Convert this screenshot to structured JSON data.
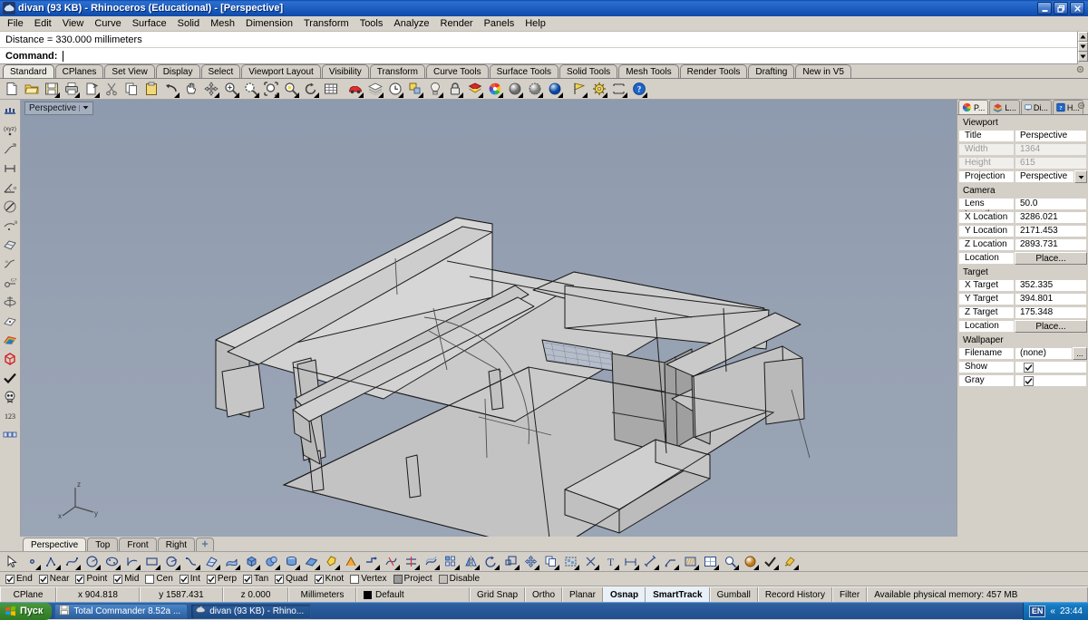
{
  "window": {
    "title": "divan (93 KB) - Rhinoceros (Educational) - [Perspective]",
    "icon": "rhino-icon",
    "minimize_label": "Minimize",
    "restore_label": "Restore",
    "close_label": "Close"
  },
  "menu": {
    "items": [
      "File",
      "Edit",
      "View",
      "Curve",
      "Surface",
      "Solid",
      "Mesh",
      "Dimension",
      "Transform",
      "Tools",
      "Analyze",
      "Render",
      "Panels",
      "Help"
    ]
  },
  "command_area": {
    "history": "Distance = 330.000 millimeters",
    "prompt_label": "Command:",
    "input_value": "",
    "scroll_up": "▲",
    "scroll_down": "▼"
  },
  "toolbar_tabs": {
    "items": [
      "Standard",
      "CPlanes",
      "Set View",
      "Display",
      "Select",
      "Viewport Layout",
      "Visibility",
      "Transform",
      "Curve Tools",
      "Surface Tools",
      "Solid Tools",
      "Mesh Tools",
      "Render Tools",
      "Drafting",
      "New in V5"
    ],
    "active": "Standard",
    "options_icon": "gear-icon"
  },
  "main_toolbar": {
    "buttons": [
      {
        "name": "new-file-icon",
        "label": "New"
      },
      {
        "name": "open-file-icon",
        "label": "Open"
      },
      {
        "name": "save-file-icon",
        "label": "Save"
      },
      {
        "name": "print-icon",
        "label": "Print"
      },
      {
        "name": "copy-page-icon",
        "label": "Copy viewport"
      },
      {
        "name": "cut-icon",
        "label": "Cut"
      },
      {
        "name": "copy-icon",
        "label": "Copy"
      },
      {
        "name": "paste-icon",
        "label": "Paste"
      },
      {
        "name": "undo-icon",
        "label": "Undo"
      },
      {
        "name": "pan-hand-icon",
        "label": "Pan"
      },
      {
        "name": "move-arrows-icon",
        "label": "Move"
      },
      {
        "name": "zoom-in-icon",
        "label": "Zoom in"
      },
      {
        "name": "zoom-window-icon",
        "label": "Zoom window"
      },
      {
        "name": "zoom-extents-icon",
        "label": "Zoom extents"
      },
      {
        "name": "zoom-selected-icon",
        "label": "Zoom selected"
      },
      {
        "name": "rotate-view-icon",
        "label": "Rotate view"
      },
      {
        "name": "grid-icon",
        "label": "Grid"
      },
      {
        "name": "render-car-icon",
        "label": "Render"
      },
      {
        "name": "layers-icon",
        "label": "Layers"
      },
      {
        "name": "clock-icon",
        "label": "History"
      },
      {
        "name": "object-props-icon",
        "label": "Properties"
      },
      {
        "name": "lightbulb-icon",
        "label": "Lights"
      },
      {
        "name": "lock-icon",
        "label": "Lock"
      },
      {
        "name": "shade-icon",
        "label": "Shade"
      },
      {
        "name": "color-wheel-icon",
        "label": "Color"
      },
      {
        "name": "sphere-shaded-icon",
        "label": "Shaded view"
      },
      {
        "name": "sphere-ghost-icon",
        "label": "Ghosted view"
      },
      {
        "name": "sphere-render-icon",
        "label": "Rendered view"
      },
      {
        "name": "flag-icon",
        "label": "Named view"
      },
      {
        "name": "options-gear-icon",
        "label": "Options"
      },
      {
        "name": "dimension-icon",
        "label": "Dimension"
      },
      {
        "name": "help-icon",
        "label": "Help"
      }
    ]
  },
  "left_toolbar": {
    "buttons": [
      {
        "name": "points-row-icon"
      },
      {
        "name": "xyz-point-icon"
      },
      {
        "name": "curve-tangent-icon"
      },
      {
        "name": "distance-icon"
      },
      {
        "name": "angle-icon"
      },
      {
        "name": "length-icon"
      },
      {
        "name": "radius-icon"
      },
      {
        "name": "surface-area-icon"
      },
      {
        "name": "curvature-icon"
      },
      {
        "name": "degree-icon"
      },
      {
        "name": "volume-icon"
      },
      {
        "name": "mass-icon"
      },
      {
        "name": "rainbow-icon"
      },
      {
        "name": "red-box-icon"
      },
      {
        "name": "check-icon"
      },
      {
        "name": "skull-icon"
      },
      {
        "name": "numbers-123-icon"
      },
      {
        "name": "grid-nums-icon"
      }
    ]
  },
  "viewport": {
    "title": "Perspective",
    "dropdown_icon": "chevron-down-icon",
    "axis": {
      "x": "x",
      "y": "y",
      "z": "z"
    },
    "background_color": "#93a0b1",
    "object_fill": "#c8c8c8",
    "object_fill_dark": "#a8a8a8",
    "edge_color": "#1a1a1a"
  },
  "viewport_tabs": {
    "items": [
      "Perspective",
      "Top",
      "Front",
      "Right"
    ],
    "active": "Perspective",
    "add_label": "+"
  },
  "properties_panel": {
    "tabs": [
      {
        "name": "properties-tab",
        "label": "P...",
        "icon": "color-wheel-icon"
      },
      {
        "name": "layers-tab",
        "label": "L...",
        "icon": "layers-icon"
      },
      {
        "name": "display-tab",
        "label": "Di...",
        "icon": "monitor-icon"
      },
      {
        "name": "help-tab",
        "label": "H...",
        "icon": "help-icon"
      }
    ],
    "active_tab": "P...",
    "gear_icon": "gear-icon",
    "sections": [
      {
        "title": "Viewport",
        "rows": [
          {
            "key": "Title",
            "value": "Perspective",
            "type": "text"
          },
          {
            "key": "Width",
            "value": "1364",
            "type": "text",
            "disabled": true
          },
          {
            "key": "Height",
            "value": "615",
            "type": "text",
            "disabled": true
          },
          {
            "key": "Projection",
            "value": "Perspective",
            "type": "dropdown"
          }
        ]
      },
      {
        "title": "Camera",
        "rows": [
          {
            "key": "Lens Length",
            "value": "50.0",
            "type": "text"
          },
          {
            "key": "X Location",
            "value": "3286.021",
            "type": "text"
          },
          {
            "key": "Y Location",
            "value": "2171.453",
            "type": "text"
          },
          {
            "key": "Z Location",
            "value": "2893.731",
            "type": "text"
          },
          {
            "key": "Location",
            "value": "Place...",
            "type": "button"
          }
        ]
      },
      {
        "title": "Target",
        "rows": [
          {
            "key": "X Target",
            "value": "352.335",
            "type": "text"
          },
          {
            "key": "Y Target",
            "value": "394.801",
            "type": "text"
          },
          {
            "key": "Z Target",
            "value": "175.348",
            "type": "text"
          },
          {
            "key": "Location",
            "value": "Place...",
            "type": "button"
          }
        ]
      },
      {
        "title": "Wallpaper",
        "rows": [
          {
            "key": "Filename",
            "value": "(none)",
            "type": "file"
          },
          {
            "key": "Show",
            "value": "",
            "type": "checkbox",
            "checked": true
          },
          {
            "key": "Gray",
            "value": "",
            "type": "checkbox",
            "checked": true
          }
        ]
      }
    ]
  },
  "bottom_toolbar": {
    "buttons": [
      {
        "name": "select-arrow-icon"
      },
      {
        "name": "point-icon"
      },
      {
        "name": "polyline-icon"
      },
      {
        "name": "curve-icon"
      },
      {
        "name": "circle-icon"
      },
      {
        "name": "ellipse-icon"
      },
      {
        "name": "arc-icon"
      },
      {
        "name": "rectangle-icon"
      },
      {
        "name": "polygon-icon"
      },
      {
        "name": "freeform-curve-icon"
      },
      {
        "name": "surface-from-curves-icon"
      },
      {
        "name": "surface-patch-icon"
      },
      {
        "name": "box-icon"
      },
      {
        "name": "sphere-icon"
      },
      {
        "name": "cylinder-icon"
      },
      {
        "name": "plane-surface-icon"
      },
      {
        "name": "boolean-union-icon"
      },
      {
        "name": "fillet-icon"
      },
      {
        "name": "chamfer-icon"
      },
      {
        "name": "trim-icon"
      },
      {
        "name": "split-icon"
      },
      {
        "name": "offset-icon"
      },
      {
        "name": "array-icon"
      },
      {
        "name": "mirror-icon"
      },
      {
        "name": "rotate-icon"
      },
      {
        "name": "scale-icon"
      },
      {
        "name": "move-icon"
      },
      {
        "name": "copy-obj-icon"
      },
      {
        "name": "group-icon"
      },
      {
        "name": "explode-icon"
      },
      {
        "name": "text-icon"
      },
      {
        "name": "dim-linear-icon"
      },
      {
        "name": "dim-aligned-icon"
      },
      {
        "name": "leader-icon"
      },
      {
        "name": "hatch-icon"
      },
      {
        "name": "layout-icon"
      },
      {
        "name": "analyze-icon"
      },
      {
        "name": "render-tools-icon"
      },
      {
        "name": "check-obj-icon"
      },
      {
        "name": "paint-icon"
      }
    ]
  },
  "osnap": {
    "items": [
      {
        "label": "End",
        "checked": true
      },
      {
        "label": "Near",
        "checked": true
      },
      {
        "label": "Point",
        "checked": true
      },
      {
        "label": "Mid",
        "checked": true
      },
      {
        "label": "Cen",
        "checked": false
      },
      {
        "label": "Int",
        "checked": true
      },
      {
        "label": "Perp",
        "checked": true
      },
      {
        "label": "Tan",
        "checked": true
      },
      {
        "label": "Quad",
        "checked": true
      },
      {
        "label": "Knot",
        "checked": true
      },
      {
        "label": "Vertex",
        "checked": false
      },
      {
        "label": "Project",
        "checked": false,
        "style": "solid"
      },
      {
        "label": "Disable",
        "checked": false,
        "style": "grey"
      }
    ]
  },
  "statusbar": {
    "cplane_label": "CPlane",
    "x": "x 904.818",
    "y": "y 1587.431",
    "z": "z 0.000",
    "units": "Millimeters",
    "layer": "Default",
    "layer_color": "#000000",
    "toggles": [
      {
        "label": "Grid Snap",
        "active": false
      },
      {
        "label": "Ortho",
        "active": false
      },
      {
        "label": "Planar",
        "active": false
      },
      {
        "label": "Osnap",
        "active": true
      },
      {
        "label": "SmartTrack",
        "active": true
      },
      {
        "label": "Gumball",
        "active": false
      },
      {
        "label": "Record History",
        "active": false
      },
      {
        "label": "Filter",
        "active": false
      }
    ],
    "memory": "Available physical memory: 457 MB"
  },
  "taskbar": {
    "start_label": "Пуск",
    "tasks": [
      {
        "label": "Total Commander 8.52a ...",
        "icon": "floppy-icon",
        "active": false
      },
      {
        "label": "divan (93 KB) - Rhino...",
        "icon": "rhino-icon",
        "active": true
      }
    ],
    "language": "EN",
    "chevron": "«",
    "clock": "23:44"
  }
}
